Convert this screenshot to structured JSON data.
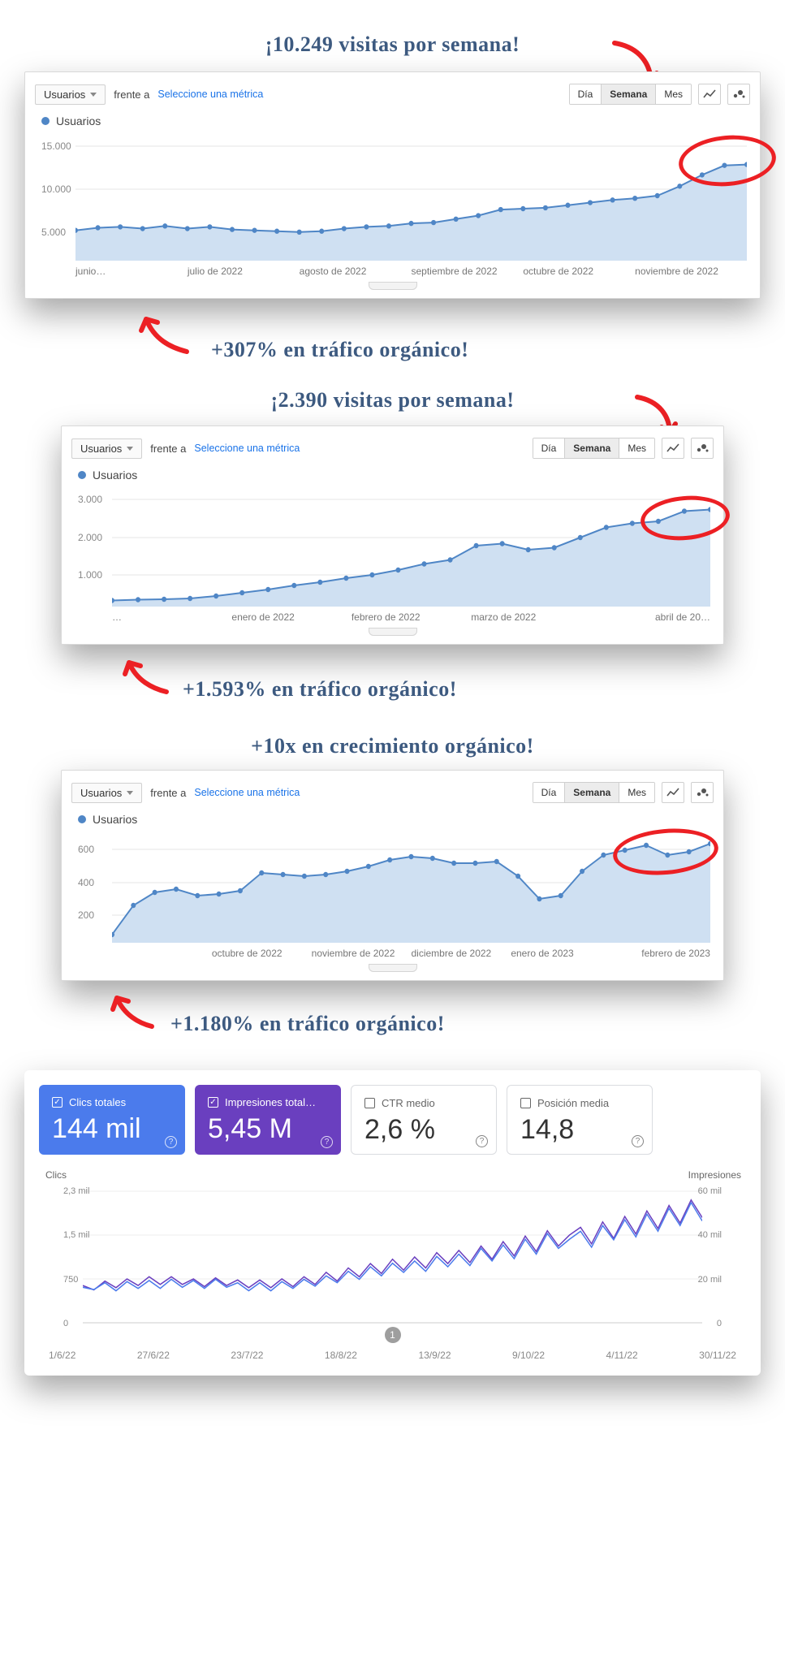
{
  "annotations": {
    "block1_top": "¡10.249 visitas por semana!",
    "block1_bottom": "+307% en tráfico orgánico!",
    "block2_top": "¡2.390 visitas por semana!",
    "block2_bottom": "+1.593% en tráfico orgánico!",
    "block3_top": "+10x en crecimiento orgánico!",
    "block3_bottom": "+1.180% en tráfico orgánico!"
  },
  "ga": {
    "metric_dd": "Usuarios",
    "frente": "frente a",
    "select_metric": "Seleccione una métrica",
    "period": {
      "day": "Día",
      "week": "Semana",
      "month": "Mes"
    },
    "legend": "Usuarios"
  },
  "gsc": {
    "tiles": [
      {
        "label": "Clics totales",
        "value": "144 mil",
        "checked": true,
        "color": "blue"
      },
      {
        "label": "Impresiones total…",
        "value": "5,45 M",
        "checked": true,
        "color": "purple"
      },
      {
        "label": "CTR medio",
        "value": "2,6 %",
        "checked": false,
        "color": "grey"
      },
      {
        "label": "Posición media",
        "value": "14,8",
        "checked": false,
        "color": "grey"
      }
    ],
    "yl_title": "Clics",
    "yr_title": "Impresiones",
    "yl_ticks": [
      "2,3 mil",
      "1,5 mil",
      "750",
      "0"
    ],
    "yr_ticks": [
      "60 mil",
      "40 mil",
      "20 mil",
      "0"
    ],
    "x_ticks": [
      "1/6/22",
      "27/6/22",
      "23/7/22",
      "18/8/22",
      "13/9/22",
      "9/10/22",
      "4/11/22",
      "30/11/22"
    ],
    "marker": "1"
  },
  "chart_data": [
    {
      "type": "line",
      "title": "Usuarios (Google Analytics) — semanal, junio–noviembre 2022",
      "x_labels": [
        "junio…",
        "julio de 2022",
        "agosto de 2022",
        "septiembre de 2022",
        "octubre de 2022",
        "noviembre de 2022"
      ],
      "ylabel": "Usuarios",
      "y_ticks": [
        5000,
        10000,
        15000
      ],
      "ylim": [
        0,
        15000
      ],
      "values": [
        3500,
        3800,
        3900,
        3700,
        4000,
        3700,
        3900,
        3600,
        3500,
        3400,
        3300,
        3400,
        3700,
        3900,
        4000,
        4300,
        4400,
        4800,
        5200,
        5900,
        6000,
        6100,
        6400,
        6700,
        7000,
        7200,
        7500,
        8600,
        9900,
        11000,
        11100
      ],
      "highlight": 10249
    },
    {
      "type": "line",
      "title": "Usuarios (Google Analytics) — semanal, ene–abr 2022",
      "x_labels": [
        "…",
        "enero de 2022",
        "febrero de 2022",
        "marzo de 2022",
        "abril de 20…"
      ],
      "ylabel": "Usuarios",
      "y_ticks": [
        1000,
        2000,
        3000
      ],
      "ylim": [
        0,
        3000
      ],
      "values": [
        150,
        170,
        180,
        200,
        260,
        340,
        420,
        520,
        600,
        700,
        780,
        900,
        1050,
        1150,
        1500,
        1550,
        1400,
        1450,
        1700,
        1950,
        2050,
        2100,
        2350,
        2390
      ],
      "highlight": 2390
    },
    {
      "type": "line",
      "title": "Usuarios (Google Analytics) — semanal, oct 2022–feb 2023",
      "x_labels": [
        "",
        "octubre de 2022",
        "noviembre de 2022",
        "diciembre de 2022",
        "enero de 2023",
        "febrero de 2023"
      ],
      "ylabel": "Usuarios",
      "y_ticks": [
        200,
        400,
        600
      ],
      "ylim": [
        0,
        700
      ],
      "values": [
        50,
        230,
        310,
        330,
        290,
        300,
        320,
        430,
        420,
        410,
        420,
        440,
        470,
        510,
        530,
        520,
        490,
        490,
        500,
        410,
        270,
        290,
        440,
        540,
        570,
        600,
        540,
        560,
        610
      ],
      "highlight": 610
    },
    {
      "type": "line",
      "title": "Google Search Console — Clics e Impresiones diarios",
      "x": [
        "1/6/22",
        "27/6/22",
        "23/7/22",
        "18/8/22",
        "13/9/22",
        "9/10/22",
        "4/11/22",
        "30/11/22"
      ],
      "series": [
        {
          "name": "Clics",
          "axis": "left",
          "ylim": [
            0,
            2300
          ],
          "values": [
            620,
            580,
            700,
            560,
            720,
            600,
            740,
            600,
            760,
            620,
            740,
            600,
            760,
            620,
            700,
            560,
            700,
            560,
            720,
            600,
            760,
            640,
            820,
            700,
            900,
            760,
            980,
            820,
            1040,
            880,
            1080,
            900,
            1160,
            980,
            1200,
            1000,
            1300,
            1080,
            1360,
            1120,
            1460,
            1200,
            1560,
            1300,
            1460,
            1600,
            1320,
            1700,
            1450,
            1800,
            1500,
            1900,
            1600,
            2000,
            1700,
            2100,
            1780
          ]
        },
        {
          "name": "Impresiones",
          "axis": "right",
          "ylim": [
            0,
            60000
          ],
          "values": [
            17000,
            15000,
            19000,
            16000,
            20000,
            17000,
            21000,
            17500,
            21000,
            17500,
            20000,
            16500,
            20500,
            17000,
            19500,
            16000,
            19500,
            16000,
            20000,
            16500,
            21000,
            17500,
            23000,
            19000,
            25000,
            21000,
            27000,
            22500,
            29000,
            24000,
            30000,
            25000,
            32000,
            27000,
            33000,
            27500,
            35000,
            29000,
            37000,
            30500,
            39500,
            32500,
            42000,
            35000,
            40000,
            43500,
            36000,
            46000,
            38500,
            48500,
            40500,
            51000,
            43000,
            53500,
            45500,
            56000,
            48000
          ]
        }
      ]
    }
  ]
}
